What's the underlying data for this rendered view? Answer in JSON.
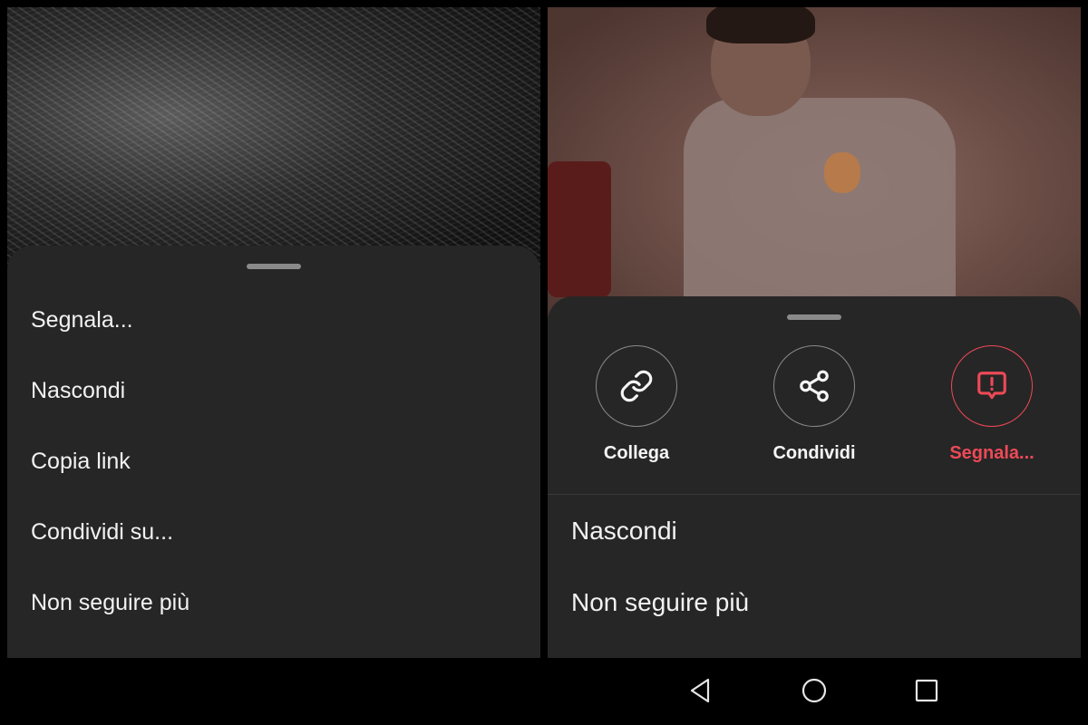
{
  "left_sheet": {
    "items": [
      {
        "label": "Segnala..."
      },
      {
        "label": "Nascondi"
      },
      {
        "label": "Copia link"
      },
      {
        "label": "Condividi su..."
      },
      {
        "label": "Non seguire più"
      }
    ]
  },
  "right_sheet": {
    "actions": [
      {
        "label": "Collega",
        "icon": "link-icon"
      },
      {
        "label": "Condividi",
        "icon": "share-icon"
      },
      {
        "label": "Segnala...",
        "icon": "report-icon"
      }
    ],
    "items": [
      {
        "label": "Nascondi"
      },
      {
        "label": "Non seguire più"
      }
    ]
  },
  "nav_bar": {
    "buttons": [
      "back-icon",
      "home-icon",
      "recents-icon"
    ]
  },
  "colors": {
    "sheet_bg": "#262626",
    "report_accent": "#ed4956",
    "text": "#f2f2f2"
  }
}
